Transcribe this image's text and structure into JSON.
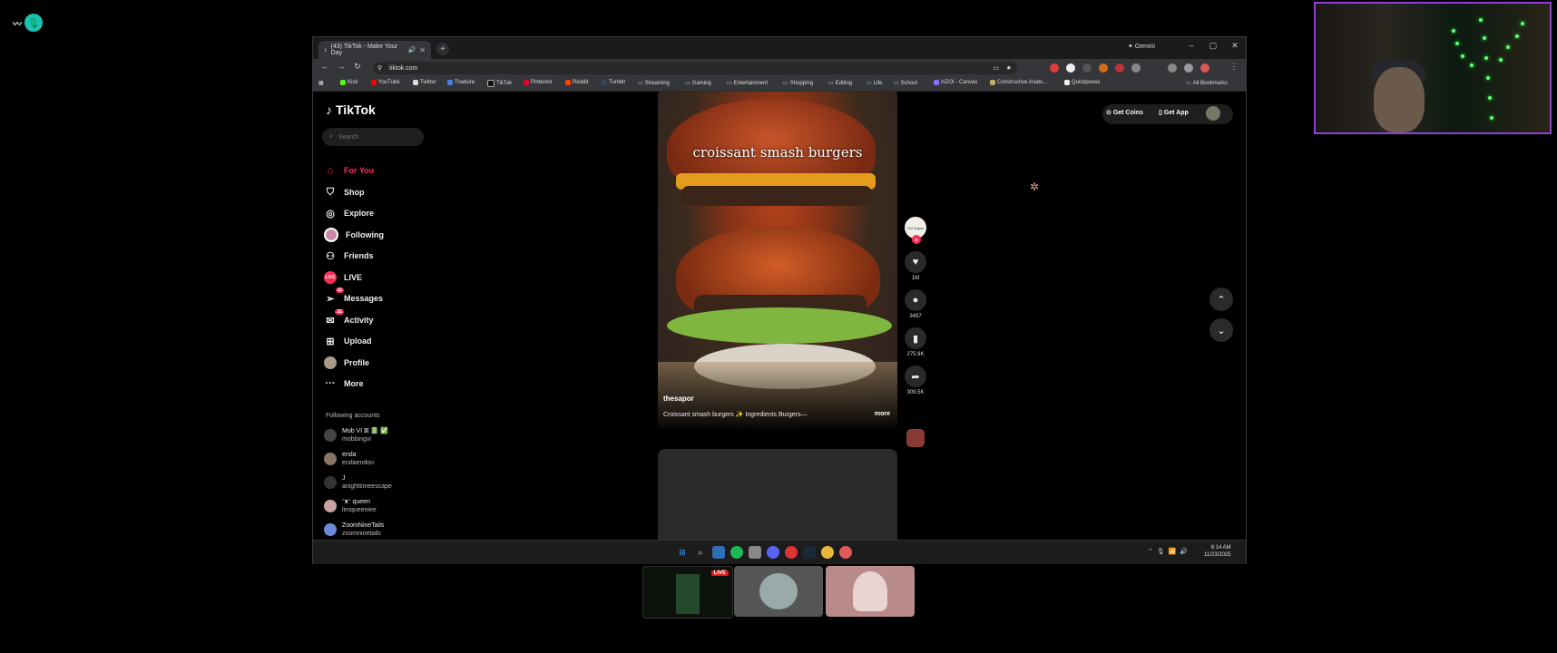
{
  "browser": {
    "tab_title": "(43) TikTok - Make Your Day",
    "new_tab": "+",
    "gemini": "✦ Gemini",
    "url": "tiktok.com",
    "bookmarks": [
      "Kick",
      "YouTube",
      "Twitter",
      "Traduire",
      "TikTok",
      "Pinterest",
      "Reddit",
      "Tumblr",
      "Streaming",
      "Gaming",
      "Entertainment",
      "Shopping",
      "Editing",
      "Life",
      "School",
      "inZOI - Canvas",
      "Constructive Anato...",
      "Quickposes"
    ],
    "all_bookmarks": "All Bookmarks"
  },
  "tiktok": {
    "logo": "TikTok",
    "search_placeholder": "Search",
    "nav": [
      "For You",
      "Shop",
      "Explore",
      "Following",
      "Friends",
      "LIVE",
      "Messages",
      "Activity",
      "Upload",
      "Profile",
      "More"
    ],
    "badges": {
      "messages": "11",
      "activity": "32"
    },
    "following_header": "Following accounts",
    "accounts": [
      {
        "name": "Mob VI 🗷 📗 ✅",
        "handle": "mobbingvi"
      },
      {
        "name": "enda",
        "handle": "endaendoo"
      },
      {
        "name": "J",
        "handle": "anighttimeescape"
      },
      {
        "name": "ᵔᴥᵔ queen",
        "handle": "limqueeniee"
      },
      {
        "name": "ZoomNineTails",
        "handle": "zoomninetails"
      }
    ],
    "video": {
      "caption_overlay": "croissant smash burgers",
      "username": "thesapor",
      "description": "Croissant smash burgers ✨ Ingredients Burgers—",
      "more": "more"
    },
    "creator_avatar_text": "The Sapor",
    "counts": {
      "likes": "1M",
      "comments": "3497",
      "saves": "275.9K",
      "shares": "309.5K"
    },
    "get_coins": "Get Coins",
    "get_app": "Get App"
  },
  "taskbar": {
    "time": "6:14 AM",
    "date": "11/23/2025"
  },
  "stream": {
    "live_label": "LIVE"
  },
  "colors": {
    "accent": "#fe2c55",
    "webcam_border": "#8e3fd8",
    "live_red": "#e91916"
  }
}
